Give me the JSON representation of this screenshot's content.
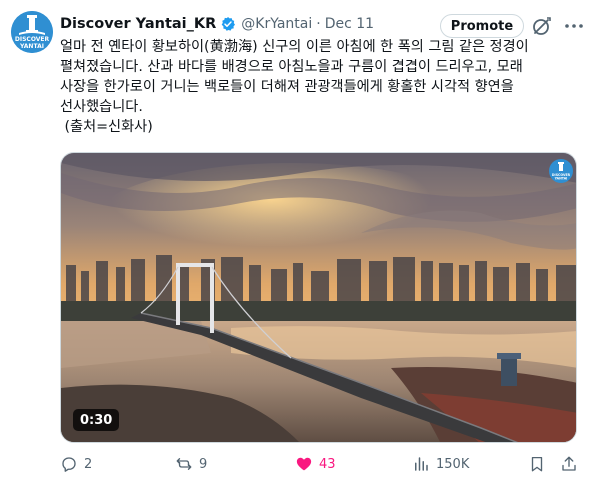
{
  "author": {
    "display_name": "Discover Yantai_KR",
    "handle": "@KrYantai",
    "separator": "·",
    "date": "Dec 11",
    "avatar_text_line1": "DISCOVER",
    "avatar_text_line2": "YANTAI",
    "verified_icon": "verified-badge-icon"
  },
  "header": {
    "promote_label": "Promote"
  },
  "tweet": {
    "lines": [
      "얼마 전 옌타이 황보하이(黄渤海) 신구의 이른 아침에 한 폭의 그림 같은 정경이",
      "펼쳐졌습니다. 산과 바다를 배경으로 아침노을과 구름이 겹겹이 드리우고, 모래",
      "사장을 한가로이 거니는 백로들이 더해져 관광객들에게 황홀한 시각적 향연을",
      "선사했습니다.",
      " (출처=신화사)"
    ]
  },
  "media": {
    "duration": "0:30",
    "watermark_line1": "DISCOVER",
    "watermark_line2": "YANTAI"
  },
  "actions": {
    "replies": "2",
    "reposts": "9",
    "likes": "43",
    "views": "150K"
  },
  "colors": {
    "like_pink": "#f91880",
    "secondary_gray": "#536471",
    "verified_blue": "#1d9bf0"
  }
}
